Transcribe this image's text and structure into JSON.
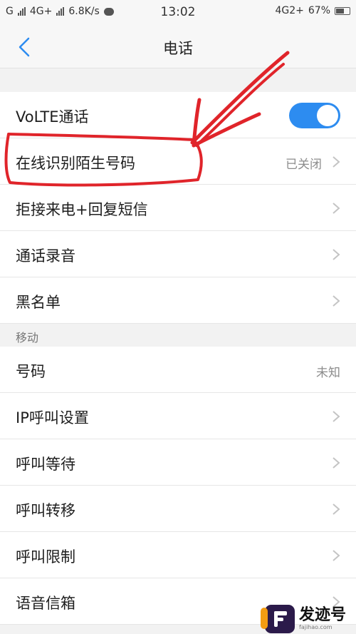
{
  "status_bar": {
    "carrier_left": "G",
    "network": "4G+",
    "speed": "6.8K/s",
    "time": "13:02",
    "network_right": "4G2+",
    "battery": "67%",
    "battery_level": 0.67
  },
  "nav": {
    "title": "电话"
  },
  "rows_top": [
    {
      "label": "VoLTE通话",
      "toggle_on": true
    },
    {
      "label": "在线识别陌生号码",
      "value": "已关闭"
    },
    {
      "label": "拒接来电+回复短信"
    },
    {
      "label": "通话录音"
    },
    {
      "label": "黑名单"
    }
  ],
  "section": {
    "title": "移动"
  },
  "rows_bottom": [
    {
      "label": "号码",
      "value": "未知"
    },
    {
      "label": "IP呼叫设置"
    },
    {
      "label": "呼叫等待"
    },
    {
      "label": "呼叫转移"
    },
    {
      "label": "呼叫限制"
    },
    {
      "label": "语音信箱"
    }
  ],
  "colors": {
    "accent": "#2d8cf0",
    "annotation": "#e0242a"
  },
  "watermark": {
    "name": "发迹号",
    "url": "fajihao.com"
  }
}
